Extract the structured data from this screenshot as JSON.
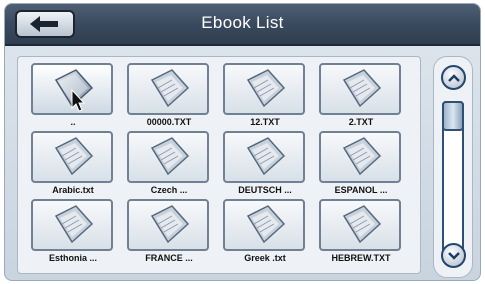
{
  "title": "Ebook List",
  "icons": {
    "back": "back-arrow-icon",
    "file": "book-file-icon",
    "cursor": "pointer-cursor-icon",
    "scroll_up": "chevron-up-icon",
    "scroll_down": "chevron-down-icon"
  },
  "files": [
    {
      "label": ".."
    },
    {
      "label": "00000.TXT"
    },
    {
      "label": "12.TXT"
    },
    {
      "label": "2.TXT"
    },
    {
      "label": "Arabic.txt"
    },
    {
      "label": "Czech ..."
    },
    {
      "label": "DEUTSCH ..."
    },
    {
      "label": "ESPANOL ..."
    },
    {
      "label": "Esthonia ..."
    },
    {
      "label": "FRANCE ..."
    },
    {
      "label": "Greek .txt"
    },
    {
      "label": "HEBREW.TXT"
    }
  ],
  "scroll_position": 0,
  "colors": {
    "title_bar": "#3a4a5e",
    "accent": "#24456e"
  }
}
